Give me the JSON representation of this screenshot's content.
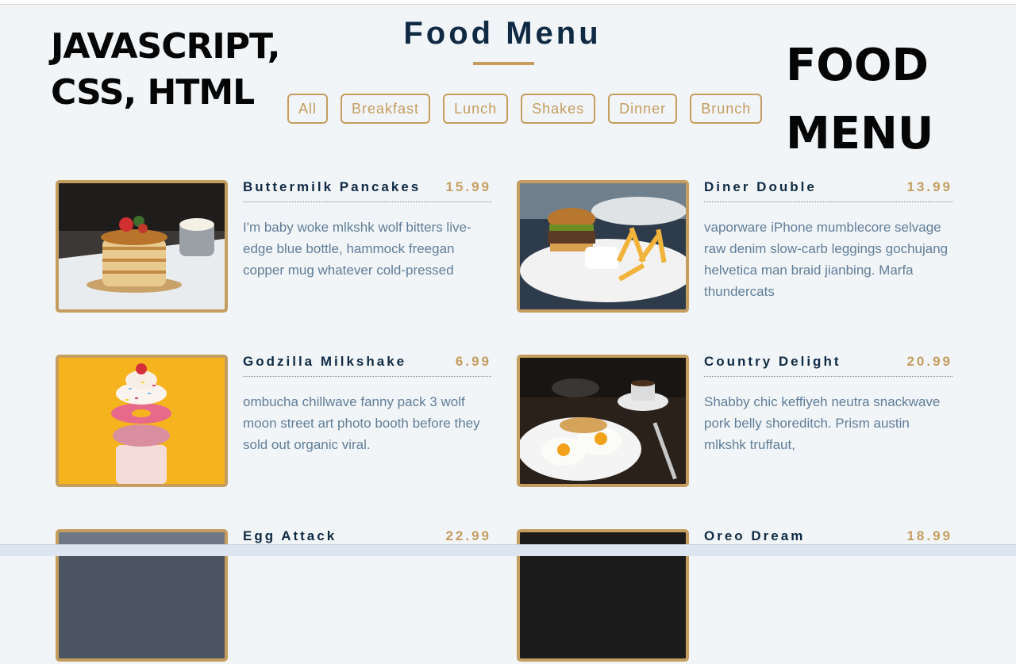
{
  "overlay": {
    "left_text": "JAVASCRIPT, CSS, HTML",
    "right_text": "FOOD MENU"
  },
  "header": {
    "title": "Food Menu"
  },
  "filters": [
    "All",
    "Breakfast",
    "Lunch",
    "Shakes",
    "Dinner",
    "Brunch"
  ],
  "items": [
    {
      "name": "Buttermilk Pancakes",
      "price": "15.99",
      "desc": "I'm baby woke mlkshk wolf bitters live-edge blue bottle, hammock freegan copper mug whatever cold-pressed",
      "image": "pancakes-photo"
    },
    {
      "name": "Diner Double",
      "price": "13.99",
      "desc": "vaporware iPhone mumblecore selvage raw denim slow-carb leggings gochujang helvetica man braid jianbing. Marfa thundercats",
      "image": "burger-photo"
    },
    {
      "name": "Godzilla Milkshake",
      "price": "6.99",
      "desc": "ombucha chillwave fanny pack 3 wolf moon street art photo booth before they sold out organic viral.",
      "image": "milkshake-photo"
    },
    {
      "name": "Country Delight",
      "price": "20.99",
      "desc": "Shabby chic keffiyeh neutra snackwave pork belly shoreditch. Prism austin mlkshk truffaut,",
      "image": "eggs-breakfast-photo"
    },
    {
      "name": "Egg Attack",
      "price": "22.99",
      "desc": "",
      "image": "egg-attack-photo"
    },
    {
      "name": "Oreo Dream",
      "price": "18.99",
      "desc": "",
      "image": "oreo-dream-photo"
    }
  ],
  "colors": {
    "accent": "#c59d5f",
    "title": "#102a43",
    "text": "#617d98",
    "background": "#f1f5f8"
  }
}
